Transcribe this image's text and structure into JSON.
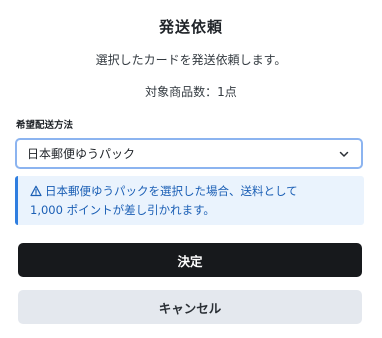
{
  "dialog": {
    "title": "発送依頼",
    "description": "選択したカードを発送依頼します。",
    "item_count": "対象商品数：1点"
  },
  "shipping": {
    "label": "希望配送方法",
    "selected": "日本郵便ゆうパック",
    "icon": "chevron-down-icon"
  },
  "notice": {
    "icon": "warning-triangle-icon",
    "line1": "日本郵便ゆうパックを選択した場合、送料として",
    "line2": "1,000 ポイントが差し引かれます。"
  },
  "actions": {
    "confirm_label": "決定",
    "cancel_label": "キャンセル"
  },
  "colors": {
    "primary_button": "#17191c",
    "secondary_button": "#e4e8ee",
    "notice_bg": "#eaf3fd",
    "notice_accent": "#2f7ee0",
    "notice_text": "#1b5fb5",
    "select_border": "#8cb4f0"
  }
}
